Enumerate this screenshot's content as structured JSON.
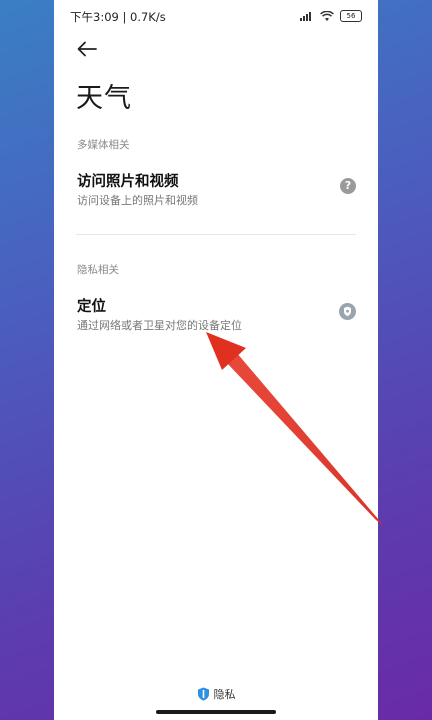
{
  "status_bar": {
    "time_speed": "下午3:09 | 0.7K/s",
    "battery": "56",
    "icons": [
      "signal-icon",
      "wifi-icon",
      "battery-icon"
    ]
  },
  "header": {
    "back_icon": "back-arrow-icon",
    "title": "天气"
  },
  "sections": [
    {
      "header": "多媒体相关",
      "items": [
        {
          "title": "访问照片和视频",
          "subtitle": "访问设备上的照片和视频",
          "icon": "help-icon",
          "icon_glyph": "?"
        }
      ]
    },
    {
      "header": "隐私相关",
      "items": [
        {
          "title": "定位",
          "subtitle": "通过网络或者卫星对您的设备定位",
          "icon": "location-shield-icon"
        }
      ]
    }
  ],
  "footer": {
    "logo_icon": "privacy-shield-logo-icon",
    "logo_text": "隐私"
  },
  "colors": {
    "background_gradient_start": "#3a7fc4",
    "background_gradient_end": "#6a2aa8",
    "annotation_arrow": "#e02b20",
    "icon_gray": "#9a9a9a",
    "logo_blue": "#2f8fe0"
  }
}
